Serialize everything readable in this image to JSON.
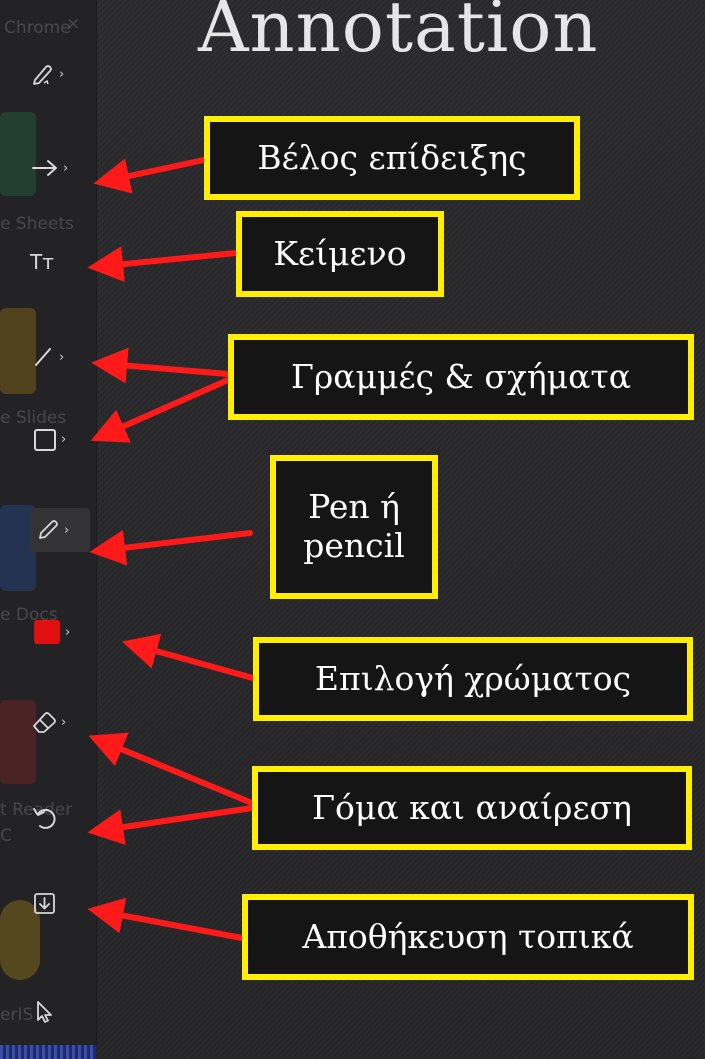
{
  "header": {
    "title": "Annotation"
  },
  "background_app": {
    "window_title": "Chrome",
    "close_glyph": "×",
    "ghost_labels": [
      "e Sheets",
      "e Slides",
      "e Docs",
      "t Reader",
      "C",
      "erIS"
    ]
  },
  "toolbar": {
    "tools": [
      {
        "name": "laser-pointer-tool",
        "icon": "laser-pen-icon",
        "chevron": "›"
      },
      {
        "name": "arrow-tool",
        "icon": "arrow-right-icon",
        "chevron": "›"
      },
      {
        "name": "text-tool",
        "icon": "text-icon",
        "glyph": "Tт"
      },
      {
        "name": "line-tool",
        "icon": "line-icon",
        "chevron": "›"
      },
      {
        "name": "shape-tool",
        "icon": "square-icon",
        "chevron": "›"
      },
      {
        "name": "pen-tool",
        "icon": "pencil-icon",
        "chevron": "›"
      },
      {
        "name": "color-picker",
        "icon": "color-swatch-icon",
        "chevron": "›",
        "color": "#e01010"
      },
      {
        "name": "eraser-tool",
        "icon": "eraser-icon",
        "chevron": "›"
      },
      {
        "name": "undo-button",
        "icon": "undo-icon"
      },
      {
        "name": "save-button",
        "icon": "download-icon"
      },
      {
        "name": "select-tool",
        "icon": "cursor-icon"
      }
    ]
  },
  "callouts": {
    "pointer_arrow": "Βέλος επίδειξης",
    "text": "Κείμενο",
    "lines_shapes": "Γραμμές & σχήματα",
    "pen_line1": "Pen ή",
    "pen_line2": "pencil",
    "color": "Επιλογή χρώματος",
    "eraser_undo": "Γόμα και αναίρεση",
    "save_local": "Αποθήκευση τοπικά"
  },
  "colors": {
    "callout_border": "#ffee00",
    "callout_background": "#151515",
    "arrow": "#ff1a1a",
    "background": "#2a2a2d"
  }
}
